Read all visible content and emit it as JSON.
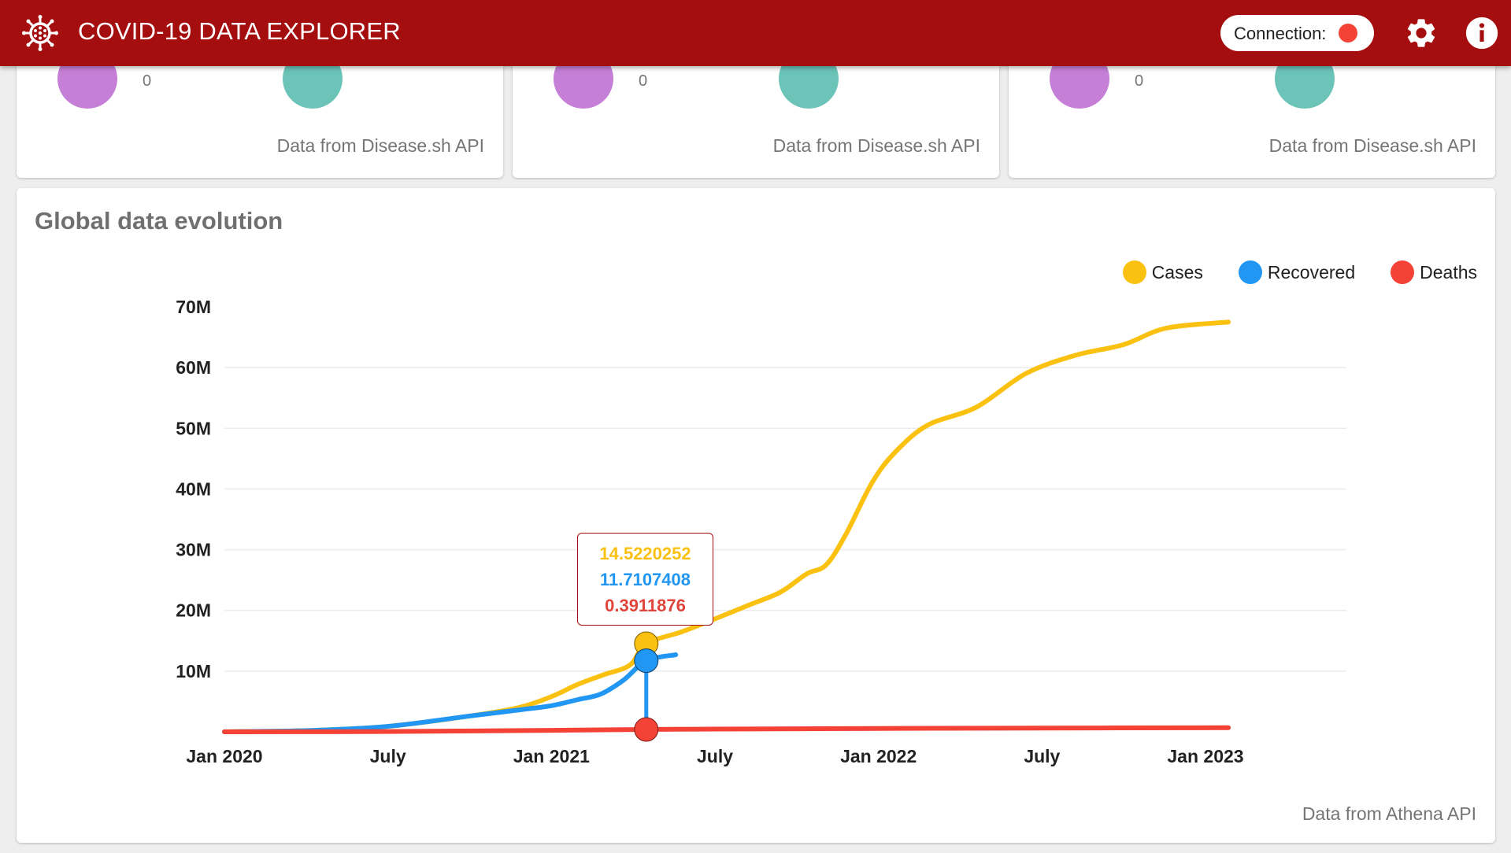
{
  "header": {
    "title": "COVID-19 DATA EXPLORER",
    "connection_label": "Connection:",
    "connection_status_color": "#f44336",
    "icons": [
      "virus-icon",
      "gear-icon",
      "info-icon"
    ],
    "bar_color": "#a50e0e"
  },
  "stat_cards": [
    {
      "value": "0",
      "source": "Data from Disease.sh API"
    },
    {
      "value": "0",
      "source": "Data from Disease.sh API"
    },
    {
      "value": "0",
      "source": "Data from Disease.sh API"
    }
  ],
  "chart_card": {
    "title": "Global data evolution",
    "source": "Data from Athena API"
  },
  "tooltip": {
    "cases": "14.5220252",
    "recovered": "11.7107408",
    "deaths": "0.3911876"
  },
  "chart_data": {
    "type": "line",
    "title": "Global data evolution",
    "xlabel": "",
    "ylabel": "",
    "x_ticks": [
      {
        "label": "Jan 2020",
        "t": 0.0
      },
      {
        "label": "July",
        "t": 0.5
      },
      {
        "label": "Jan 2021",
        "t": 1.0
      },
      {
        "label": "July",
        "t": 1.5
      },
      {
        "label": "Jan 2022",
        "t": 2.0
      },
      {
        "label": "July",
        "t": 2.5
      },
      {
        "label": "Jan 2023",
        "t": 3.0
      }
    ],
    "y_ticks": [
      {
        "label": "10M",
        "v": 10
      },
      {
        "label": "20M",
        "v": 20
      },
      {
        "label": "30M",
        "v": 30
      },
      {
        "label": "40M",
        "v": 40
      },
      {
        "label": "50M",
        "v": 50
      },
      {
        "label": "60M",
        "v": 60
      },
      {
        "label": "70M",
        "v": 70
      }
    ],
    "x_unit": "years since Jan 2020",
    "y_unit": "millions",
    "xlim": [
      0,
      3.0
    ],
    "ylim": [
      0,
      70
    ],
    "grid": true,
    "legend_position": "top-right",
    "series": [
      {
        "name": "Cases",
        "color": "#fbc111",
        "points": [
          [
            0,
            0
          ],
          [
            0.25,
            0.2
          ],
          [
            0.5,
            0.9
          ],
          [
            0.75,
            2.6
          ],
          [
            0.9,
            4.0
          ],
          [
            1.0,
            5.8
          ],
          [
            1.08,
            7.8
          ],
          [
            1.16,
            9.4
          ],
          [
            1.24,
            11.0
          ],
          [
            1.29,
            14.5
          ],
          [
            1.4,
            16.5
          ],
          [
            1.5,
            18.6
          ],
          [
            1.6,
            20.8
          ],
          [
            1.7,
            23.0
          ],
          [
            1.78,
            26.0
          ],
          [
            1.84,
            27.5
          ],
          [
            1.9,
            32.5
          ],
          [
            1.98,
            41.0
          ],
          [
            2.05,
            46.0
          ],
          [
            2.15,
            50.5
          ],
          [
            2.3,
            53.5
          ],
          [
            2.45,
            59.0
          ],
          [
            2.6,
            62.0
          ],
          [
            2.75,
            63.8
          ],
          [
            2.88,
            66.5
          ],
          [
            3.07,
            67.5
          ]
        ]
      },
      {
        "name": "Recovered",
        "color": "#2196f3",
        "points": [
          [
            0,
            0
          ],
          [
            0.25,
            0.2
          ],
          [
            0.5,
            0.9
          ],
          [
            0.75,
            2.6
          ],
          [
            0.9,
            3.6
          ],
          [
            1.0,
            4.3
          ],
          [
            1.08,
            5.3
          ],
          [
            1.15,
            6.2
          ],
          [
            1.22,
            8.5
          ],
          [
            1.29,
            11.7
          ],
          [
            1.38,
            12.7
          ]
        ]
      },
      {
        "name": "Deaths",
        "color": "#f44336",
        "points": [
          [
            0,
            0
          ],
          [
            0.5,
            0.05
          ],
          [
            1.0,
            0.25
          ],
          [
            1.29,
            0.39
          ],
          [
            1.5,
            0.45
          ],
          [
            2.0,
            0.55
          ],
          [
            2.5,
            0.62
          ],
          [
            3.07,
            0.68
          ]
        ]
      }
    ],
    "highlight": {
      "t": 1.29,
      "cases": 14.5220252,
      "recovered": 11.7107408,
      "deaths": 0.3911876
    }
  }
}
